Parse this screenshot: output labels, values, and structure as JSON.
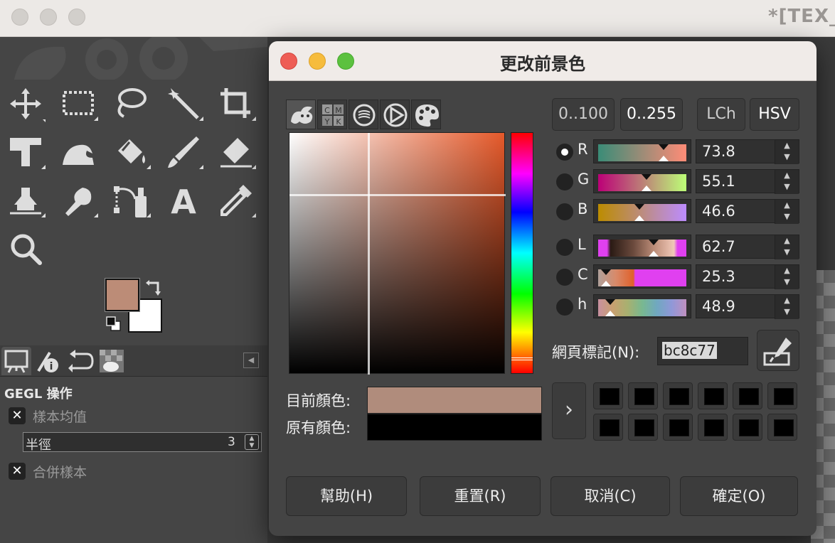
{
  "window": {
    "title": "*[TEX_",
    "traffic_lights": [
      "close",
      "minimize",
      "zoom"
    ]
  },
  "toolbox": {
    "tools": [
      "move-tool",
      "rect-select-tool",
      "free-select-tool",
      "fuzzy-select-tool",
      "crop-tool",
      "unified-transform-tool",
      "warp-transform-tool",
      "bucket-fill-tool",
      "paintbrush-tool",
      "eraser-tool",
      "clone-tool",
      "smudge-tool",
      "paths-tool",
      "text-tool",
      "color-picker-tool",
      "zoom-tool"
    ],
    "foreground_color": "#bc8c77",
    "background_color": "#ffffff"
  },
  "dock": {
    "tabs": [
      "tool-options",
      "device-status",
      "undo-history",
      "images"
    ],
    "section_title": "GEGL 操作",
    "options": {
      "sample_average_label": "樣本均值",
      "radius_label": "半徑",
      "radius_value": "3",
      "sample_merged_label": "合併樣本"
    }
  },
  "dialog": {
    "title": "更改前景色",
    "selector_tabs": [
      "gimp",
      "cmyk",
      "watercolor",
      "triangle",
      "palette"
    ],
    "range_buttons": {
      "r100": "0..100",
      "r255": "0..255",
      "lch": "LCh",
      "hsv": "HSV"
    },
    "channels": [
      {
        "label": "R",
        "value": "73.8",
        "level": 0.738,
        "selected": true,
        "gradient": "linear-gradient(to right, #3a8c77, #ff8c77)"
      },
      {
        "label": "G",
        "value": "55.1",
        "level": 0.551,
        "selected": false,
        "gradient": "linear-gradient(to right, #bc0077, #bcff77)"
      },
      {
        "label": "B",
        "value": "46.6",
        "level": 0.466,
        "selected": false,
        "gradient": "linear-gradient(to right, #bc8c00, #bc8cff)"
      },
      {
        "label": "L",
        "value": "62.7",
        "level": 0.627,
        "selected": false,
        "gradient": "linear-gradient(to right, #e040f0 0%, #e040f0 10%, #2a1a14 14%, #6b4a3d 40%, #bc8c77 63%, #f0c8b8 86%, #e040f0 90%, #e040f0 100%)"
      },
      {
        "label": "C",
        "value": "25.3",
        "level": 0.085,
        "selected": false,
        "gradient": "linear-gradient(to right, #b0a09a 0%, #d88a6a 20%, #e0602a 40%, #e040f0 42%, #e040f0 100%)"
      },
      {
        "label": "h",
        "value": "48.9",
        "level": 0.136,
        "selected": false,
        "gradient": "linear-gradient(to right, #c890a0, #c8a070, #a8b070, #78b890, #70a8c0, #9098d8, #c090c0)"
      }
    ],
    "hex_label": "網頁標記(N):",
    "hex_value": "bc8c77",
    "current_label": "目前顏色:",
    "original_label": "原有顏色:",
    "current_color": "#b08c7c",
    "original_color": "#000000",
    "history_count": 12,
    "buttons": {
      "help": "幫助(H)",
      "reset": "重置(R)",
      "cancel": "取消(C)",
      "ok": "確定(O)"
    }
  }
}
